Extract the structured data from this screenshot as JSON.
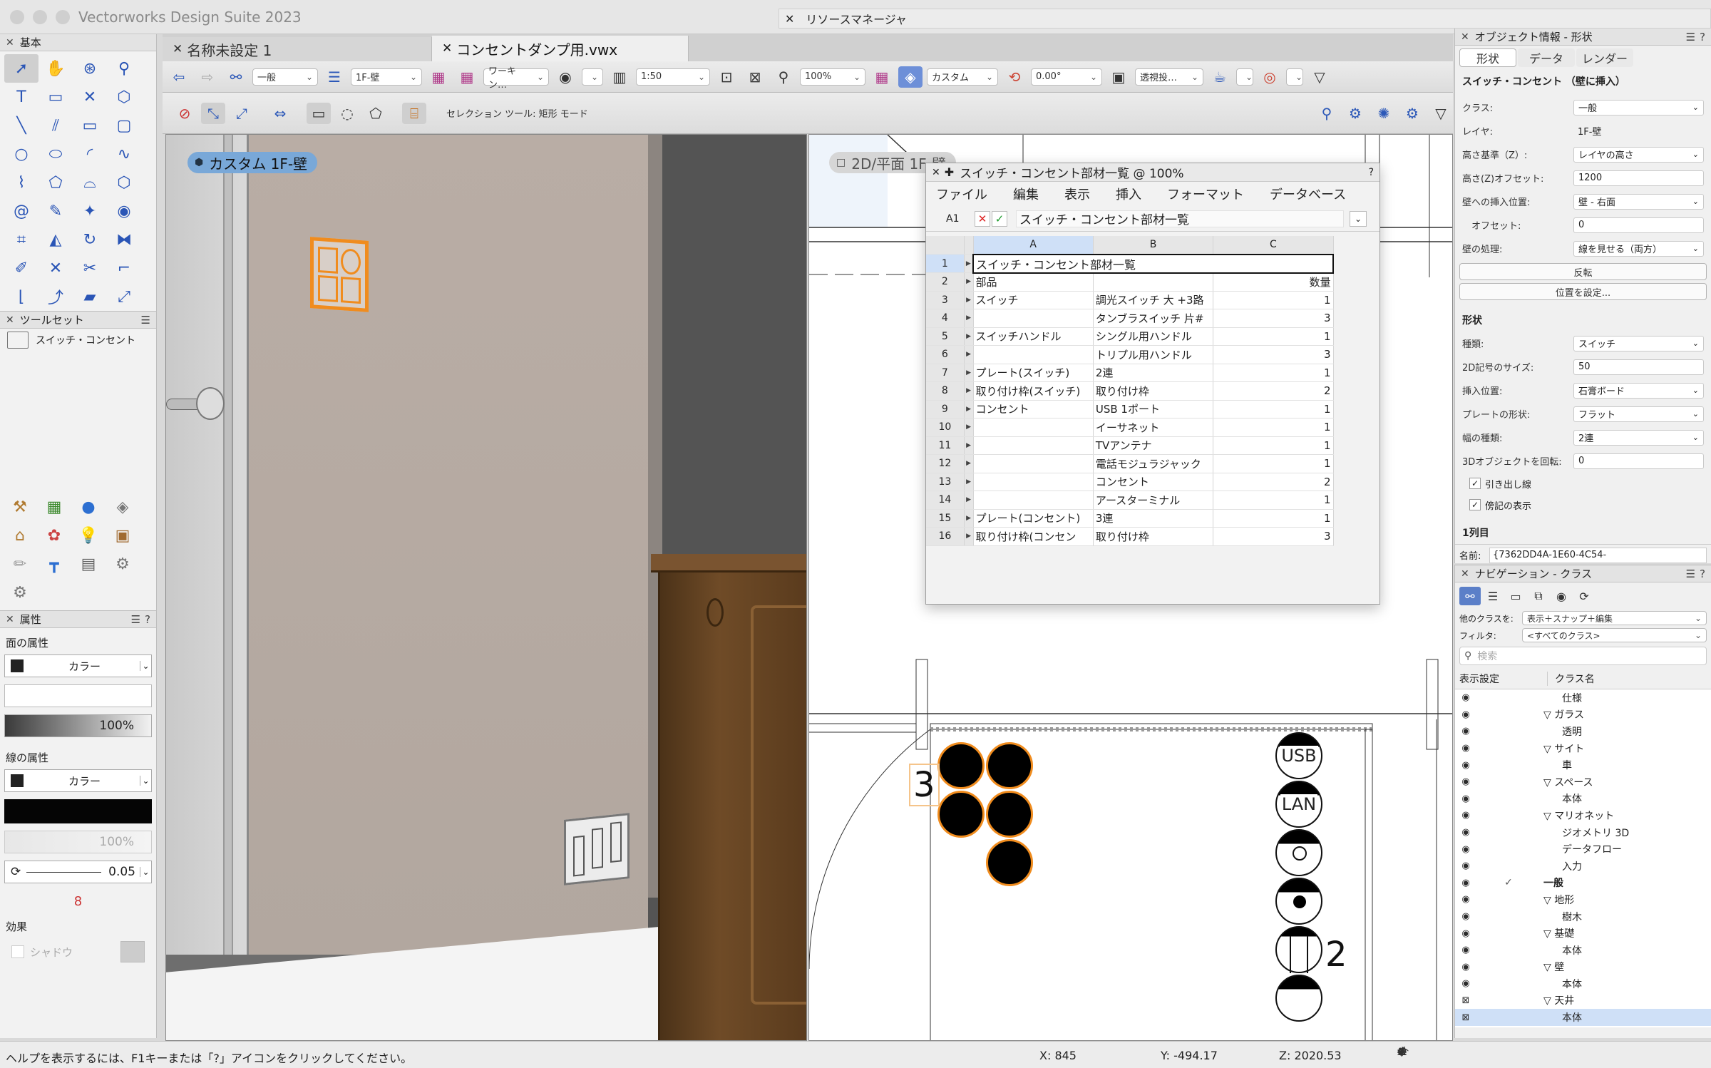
{
  "app_title": "Vectorworks Design Suite 2023",
  "resource_manager_title": "リソースマネージャ",
  "tabs": [
    {
      "label": "名称未設定 1"
    },
    {
      "label": "コンセントダンプ用.vwx"
    }
  ],
  "toolbar": {
    "class_dd": "一般",
    "layer_dd": "1F-壁",
    "workspace_dd": "ワーキン…",
    "scale": "1:50",
    "zoom": "100%",
    "view_dd": "カスタム",
    "rotation": "0.00°",
    "projection_dd": "透視投…"
  },
  "mode_bar": {
    "text": "セレクション ツール: 矩形 モード"
  },
  "basic_palette": {
    "title": "基本"
  },
  "toolset_palette": {
    "title": "ツールセット",
    "item": "スイッチ・コンセント"
  },
  "attributes": {
    "title": "属性",
    "fill_heading": "面の属性",
    "fill_type": "カラー",
    "fill_opacity": "100%",
    "line_heading": "線の属性",
    "line_type": "カラー",
    "line_opacity": "100%",
    "line_weight": "0.05",
    "effects_heading": "効果",
    "shadow_label": "シャドウ"
  },
  "viewport_left": {
    "label": "カスタム  1F-壁"
  },
  "viewport_right": {
    "label": "2D/平面  1F-壁"
  },
  "worksheet": {
    "title": "スイッチ・コンセント部材一覧 @ 100%",
    "menus": [
      "ファイル",
      "編集",
      "表示",
      "挿入",
      "フォーマット",
      "データベース"
    ],
    "cell_ref": "A1",
    "formula": "スイッチ・コンセント部材一覧",
    "columns": [
      "A",
      "B",
      "C"
    ],
    "rows": [
      {
        "n": "1",
        "a": "スイッチ・コンセント部材一覧",
        "b": "",
        "c": ""
      },
      {
        "n": "2",
        "a": "部品",
        "b": "",
        "c": "数量"
      },
      {
        "n": "3",
        "a": "スイッチ",
        "b": "調光スイッチ 大 +3路",
        "c": "1"
      },
      {
        "n": "4",
        "a": "",
        "b": "タンブラスイッチ 片#",
        "c": "3"
      },
      {
        "n": "5",
        "a": "スイッチハンドル",
        "b": "シングル用ハンドル",
        "c": "1"
      },
      {
        "n": "6",
        "a": "",
        "b": "トリプル用ハンドル",
        "c": "3"
      },
      {
        "n": "7",
        "a": "プレート(スイッチ)",
        "b": "2連",
        "c": "1"
      },
      {
        "n": "8",
        "a": "取り付け枠(スイッチ)",
        "b": "取り付け枠",
        "c": "2"
      },
      {
        "n": "9",
        "a": "コンセント",
        "b": "USB 1ポート",
        "c": "1"
      },
      {
        "n": "10",
        "a": "",
        "b": "イーサネット",
        "c": "1"
      },
      {
        "n": "11",
        "a": "",
        "b": "TVアンテナ",
        "c": "1"
      },
      {
        "n": "12",
        "a": "",
        "b": "電話モジュラジャック",
        "c": "1"
      },
      {
        "n": "13",
        "a": "",
        "b": "コンセント",
        "c": "2"
      },
      {
        "n": "14",
        "a": "",
        "b": "アースターミナル",
        "c": "1"
      },
      {
        "n": "15",
        "a": "プレート(コンセント)",
        "b": "3連",
        "c": "1"
      },
      {
        "n": "16",
        "a": "取り付け枠(コンセン",
        "b": "取り付け枠",
        "c": "3"
      }
    ]
  },
  "plan_labels": {
    "usb": "USB",
    "lan": "LAN",
    "count3": "3",
    "count2": "2"
  },
  "object_info": {
    "title": "オブジェクト情報 - 形状",
    "tabs": [
      "形状",
      "データ",
      "レンダー"
    ],
    "object_type": "スイッチ・コンセント （壁に挿入）",
    "fields": [
      {
        "label": "クラス:",
        "value": "一般",
        "kind": "dropdown"
      },
      {
        "label": "レイヤ:",
        "value": "1F-壁",
        "kind": "plain"
      },
      {
        "label": "高さ基準（Z）:",
        "value": "レイヤの高さ",
        "kind": "dropdown"
      },
      {
        "label": "高さ(Z)オフセット:",
        "value": "1200",
        "kind": "input"
      },
      {
        "label": "壁への挿入位置:",
        "value": "壁 - 右面",
        "kind": "dropdown"
      },
      {
        "label": "　オフセット:",
        "value": "0",
        "kind": "input"
      },
      {
        "label": "壁の処理:",
        "value": "線を見せる（両方）",
        "kind": "dropdown"
      }
    ],
    "flip_button": "反転",
    "position_button": "位置を設定...",
    "shape_heading": "形状",
    "shape_fields": [
      {
        "label": "種類:",
        "value": "スイッチ",
        "kind": "dropdown"
      },
      {
        "label": "2D記号のサイズ:",
        "value": "50",
        "kind": "input"
      },
      {
        "label": "挿入位置:",
        "value": "石膏ボード",
        "kind": "dropdown"
      },
      {
        "label": "プレートの形状:",
        "value": "フラット",
        "kind": "dropdown"
      },
      {
        "label": "幅の種類:",
        "value": "2連",
        "kind": "dropdown"
      },
      {
        "label": "3Dオブジェクトを回転:",
        "value": "0",
        "kind": "input"
      }
    ],
    "checkbox_leader": "引き出し線",
    "checkbox_symbol": "傍記の表示",
    "column_heading": "1列目",
    "name_label": "名前:",
    "name_value": "{7362DD4A-1E60-4C54-"
  },
  "navigation": {
    "title": "ナビゲーション - クラス",
    "other_classes_label": "他のクラスを:",
    "other_classes_value": "表示＋スナップ＋編集",
    "filter_label": "フィルタ:",
    "filter_value": "<すべてのクラス>",
    "search_placeholder": "検索",
    "col_visibility": "表示設定",
    "col_name": "クラス名",
    "rows": [
      {
        "name": "仕様",
        "level": 2,
        "tri": false
      },
      {
        "name": "ガラス",
        "level": 1,
        "tri": true
      },
      {
        "name": "透明",
        "level": 2,
        "tri": false
      },
      {
        "name": "サイト",
        "level": 1,
        "tri": true
      },
      {
        "name": "車",
        "level": 2,
        "tri": false
      },
      {
        "name": "スペース",
        "level": 1,
        "tri": true
      },
      {
        "name": "本体",
        "level": 2,
        "tri": false
      },
      {
        "name": "マリオネット",
        "level": 1,
        "tri": true
      },
      {
        "name": "ジオメトリ 3D",
        "level": 2,
        "tri": false
      },
      {
        "name": "データフロー",
        "level": 2,
        "tri": false
      },
      {
        "name": "入力",
        "level": 2,
        "tri": false
      },
      {
        "name": "一般",
        "level": 1,
        "tri": false,
        "bold": true,
        "check": true
      },
      {
        "name": "地形",
        "level": 1,
        "tri": true
      },
      {
        "name": "樹木",
        "level": 2,
        "tri": false
      },
      {
        "name": "基礎",
        "level": 1,
        "tri": true
      },
      {
        "name": "本体",
        "level": 2,
        "tri": false
      },
      {
        "name": "壁",
        "level": 1,
        "tri": true
      },
      {
        "name": "本体",
        "level": 2,
        "tri": false
      },
      {
        "name": "天井",
        "level": 1,
        "tri": true,
        "hidden": true
      },
      {
        "name": "本体",
        "level": 2,
        "tri": false,
        "hidden": true,
        "selected": true
      }
    ]
  },
  "status_bar": {
    "help": "ヘルプを表示するには、F1キーまたは「?」アイコンをクリックしてください。",
    "x": "X: 845",
    "y": "Y: -494.17",
    "z": "Z: 2020.53"
  },
  "colors": {
    "accent": "#2c58b8",
    "orange": "#f08c1e",
    "selection": "#cfe0f7"
  }
}
